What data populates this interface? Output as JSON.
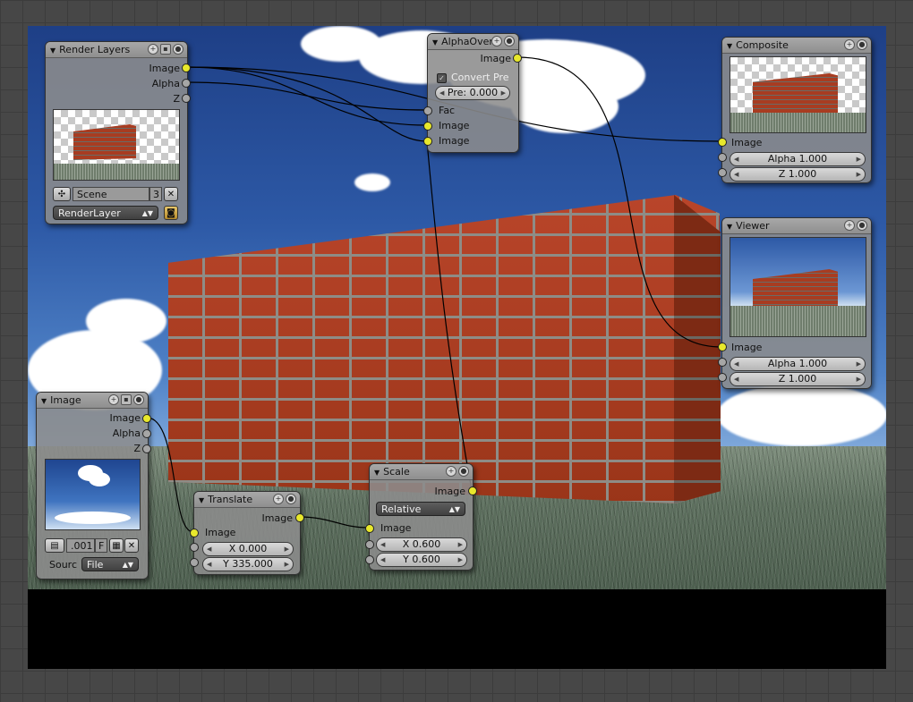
{
  "render_layers": {
    "title": "Render Layers",
    "out_image": "Image",
    "out_alpha": "Alpha",
    "out_z": "Z",
    "scene": "Scene",
    "scene_users": "3",
    "layer": "RenderLayer"
  },
  "alpha_over": {
    "title": "AlphaOver",
    "out_image": "Image",
    "convert_pre": "Convert Pre",
    "premul": "Pre: 0.000",
    "in_fac": "Fac",
    "in_image1": "Image",
    "in_image2": "Image"
  },
  "composite": {
    "title": "Composite",
    "in_image": "Image",
    "alpha": "Alpha 1.000",
    "z": "Z 1.000"
  },
  "viewer": {
    "title": "Viewer",
    "in_image": "Image",
    "alpha": "Alpha 1.000",
    "z": "Z 1.000"
  },
  "image_node": {
    "title": "Image",
    "out_image": "Image",
    "out_alpha": "Alpha",
    "out_z": "Z",
    "frame": ".001",
    "fake_user": "F",
    "source_label": "Sourc",
    "source_value": "File"
  },
  "translate": {
    "title": "Translate",
    "out_image": "Image",
    "in_image": "Image",
    "x": "X 0.000",
    "y": "Y 335.000"
  },
  "scale": {
    "title": "Scale",
    "out_image": "Image",
    "space": "Relative",
    "in_image": "Image",
    "x": "X 0.600",
    "y": "Y 0.600"
  },
  "icons": {
    "collapse": "triangle-down-icon",
    "add": "plus-icon",
    "preview": "image-preview-icon",
    "close": "close-icon",
    "scene": "scene-icon",
    "render": "camera-icon",
    "image": "image-icon",
    "folder": "folder-icon"
  },
  "colors": {
    "socket_color": "#e8e82c",
    "socket_value": "#a6a6a6",
    "node_bg": "#8c8c8c",
    "grid_bg": "#474747"
  }
}
